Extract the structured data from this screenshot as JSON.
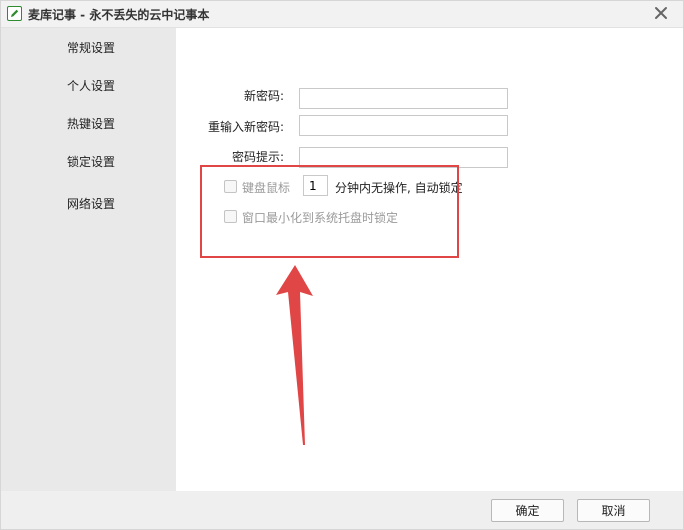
{
  "window": {
    "title": "麦库记事 - 永不丢失的云中记事本"
  },
  "sidebar": {
    "items": [
      {
        "label": "常规设置"
      },
      {
        "label": "个人设置"
      },
      {
        "label": "热键设置"
      },
      {
        "label": "锁定设置"
      },
      {
        "label": "网络设置"
      }
    ]
  },
  "form": {
    "new_password_label": "新密码:",
    "new_password_value": "",
    "confirm_password_label": "重输入新密码:",
    "confirm_password_value": "",
    "hint_label": "密码提示:",
    "hint_value": "",
    "idle_lock": {
      "checkbox_label": "键盘鼠标",
      "checked": false,
      "minutes": "1",
      "suffix": "分钟内无操作, 自动锁定"
    },
    "tray_lock": {
      "checkbox_label": "窗口最小化到系统托盘时锁定",
      "checked": false
    }
  },
  "footer": {
    "ok_label": "确定",
    "cancel_label": "取消"
  },
  "colors": {
    "annotation": "#e04646",
    "sidebar_bg": "#e9e9e9",
    "app_icon": "#2e8b2e"
  },
  "icons": {
    "app": "notebook-pencil-icon",
    "close": "close-icon"
  }
}
